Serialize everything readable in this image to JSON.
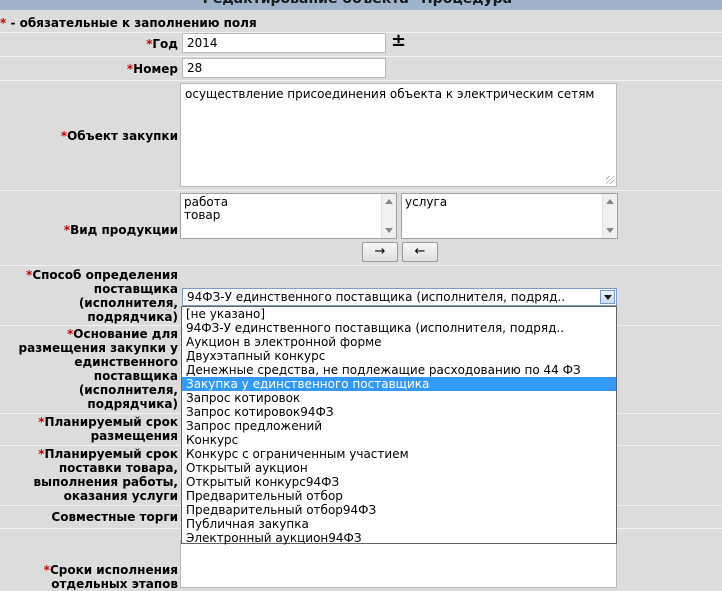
{
  "page": {
    "title": "Редактирование объекта \"Процедура\"",
    "required_note_star": "*",
    "required_note": " - обязательные к заполнению поля"
  },
  "fields": {
    "year": {
      "label": "Год",
      "value": "2014",
      "toggle": "±"
    },
    "number": {
      "label": "Номер",
      "value": "28"
    },
    "subject": {
      "label": "Объект закупки",
      "value": "осуществление присоединения объекта к электрическим сетям"
    },
    "product_type": {
      "label": "Вид продукции",
      "available": [
        "работа",
        "товар"
      ],
      "selected": [
        "услуга"
      ],
      "move_right": "→",
      "move_left": "←"
    },
    "method": {
      "label_lines": [
        "Способ определения",
        "поставщика",
        "(исполнителя,",
        "подрядчика)"
      ],
      "selected_value": "94ФЗ-У единственного поставщика (исполнителя, подряд..",
      "options": [
        "[не указано]",
        "94ФЗ-У единственного поставщика (исполнителя, подряд..",
        "Аукцион в электронной форме",
        "Двухэтапный конкурс",
        "Денежные средства, не подлежащие расходованию по 44 ФЗ",
        "Закупка у единственного поставщика",
        "Запрос котировок",
        "Запрос котировок94ФЗ",
        "Запрос предложений",
        "Конкурс",
        "Конкурс с ограниченным участием",
        "Открытый аукцион",
        "Открытый конкурс94ФЗ",
        "Предварительный отбор",
        "Предварительный отбор94ФЗ",
        "Публичная закупка",
        "Электронный аукцион94ФЗ"
      ],
      "highlighted_index": 5
    },
    "basis": {
      "label_lines": [
        "Основание для",
        "размещения закупки у",
        "единственного",
        "поставщика",
        "(исполнителя,",
        "подрядчика)"
      ]
    },
    "placement_term": {
      "label_lines": [
        "Планируемый срок",
        "размещения"
      ]
    },
    "delivery_term": {
      "label_lines": [
        "Планируемый срок",
        "поставки товара,",
        "выполнения работы,",
        "оказания услуги"
      ]
    },
    "joint": {
      "label": "Совместные торги"
    },
    "stages": {
      "label_lines": [
        "Сроки исполнения",
        "отдельных этапов"
      ]
    }
  }
}
